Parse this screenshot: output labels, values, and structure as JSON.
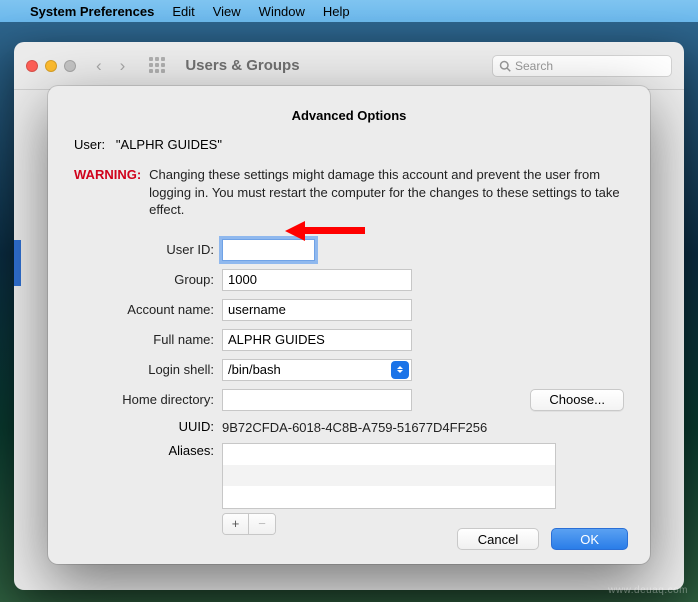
{
  "menubar": {
    "app": "System Preferences",
    "items": [
      "Edit",
      "View",
      "Window",
      "Help"
    ]
  },
  "prefs": {
    "title": "Users & Groups",
    "search_placeholder": "Search"
  },
  "sheet": {
    "title": "Advanced Options",
    "user_label": "User:",
    "user_value": "\"ALPHR GUIDES\"",
    "warning_label": "WARNING:",
    "warning_text": "Changing these settings might damage this account and prevent the user from logging in. You must restart the computer for the changes to these settings to take effect.",
    "fields": {
      "user_id": {
        "label": "User ID:",
        "value": ""
      },
      "group": {
        "label": "Group:",
        "value": "1000"
      },
      "account_name": {
        "label": "Account name:",
        "value": "username"
      },
      "full_name": {
        "label": "Full name:",
        "value": "ALPHR GUIDES"
      },
      "login_shell": {
        "label": "Login shell:",
        "value": "/bin/bash"
      },
      "home_dir": {
        "label": "Home directory:",
        "value": ""
      },
      "uuid": {
        "label": "UUID:",
        "value": "9B72CFDA-6018-4C8B-A759-51677D4FF256"
      },
      "aliases": {
        "label": "Aliases:"
      }
    },
    "choose_label": "Choose...",
    "cancel": "Cancel",
    "ok": "OK",
    "plus": "+",
    "minus": "−"
  },
  "watermark": "www.deuaq.com"
}
